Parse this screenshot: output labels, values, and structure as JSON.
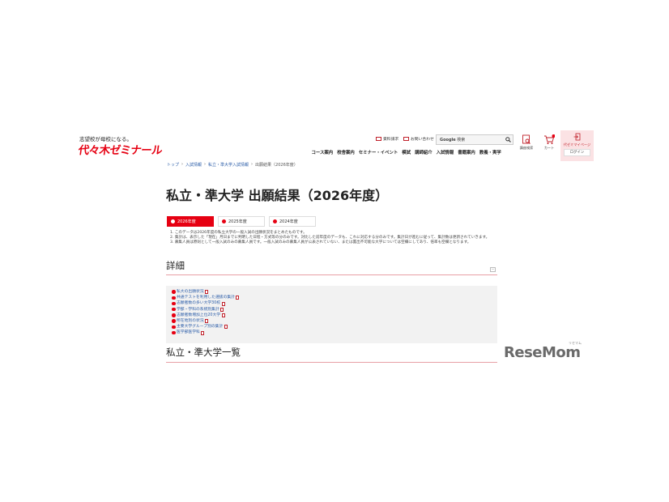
{
  "header": {
    "tagline": "志望校が母校になる。",
    "logo": "代々木ゼミナール",
    "util_links": [
      {
        "label": "資料請求",
        "icon": "book-icon"
      },
      {
        "label": "お問い合わせ",
        "icon": "mail-icon"
      }
    ],
    "search": {
      "brand": "Google",
      "placeholder": "検索",
      "icon": "search-icon"
    },
    "nav": [
      "コース案内",
      "校舎案内",
      "セミナー・イベント",
      "模試",
      "講師紹介",
      "入試情報",
      "書籍案内",
      "教養・実学"
    ],
    "icons": {
      "course_search": "講座検索",
      "cart": "カート",
      "cart_count": "0"
    },
    "mypage": {
      "label": "代ゼミマイページ",
      "login": "ログイン"
    }
  },
  "breadcrumb": {
    "items": [
      "トップ",
      "入試情報",
      "私立・準大学入試情報"
    ],
    "current": "出願結果（2026年度）",
    "separator": "›"
  },
  "page_title": "私立・準大学 出願結果（2026年度）",
  "tabs": [
    {
      "label": "2026年度",
      "active": true
    },
    {
      "label": "2025年度",
      "active": false
    },
    {
      "label": "2024年度",
      "active": false
    }
  ],
  "notes": [
    "1. このデータは2026年度の私立大学の一般入試の出願状況をまとめたものです。",
    "2. 集計は、表示した「現在」月日までに判明した日程・方式等の分のみです。対比した前年度のデータも、これに対応する分のみです。集計日が進むに従って、集計数は更新されていきます。",
    "3. 募集人員は原則として一般入試のみの募集人員です。一般入試のみの募集人員が公表されていない、または置出不可能な大学については空欄にしてあり、倍率も空欄となります。"
  ],
  "detail_section": {
    "title": "詳細",
    "toggle": "－",
    "links": [
      "私大の出願状況",
      "共通テストを利用した選抜の集計",
      "志願者数の多い大学30校",
      "学部・学科の系統別集計",
      "志願者数増加上位20大学",
      "所在地別の状況",
      "主要大学グループ別の集計",
      "医学部医学科"
    ]
  },
  "list_section": {
    "title": "私立・準大学一覧"
  },
  "watermark": {
    "brand": "ReseMom",
    "reading": "リセマム"
  },
  "colors": {
    "accent": "#e60012",
    "link": "#2a5ca8",
    "section_rule": "#e8a0a6",
    "detail_bg": "#f2f2f2"
  }
}
